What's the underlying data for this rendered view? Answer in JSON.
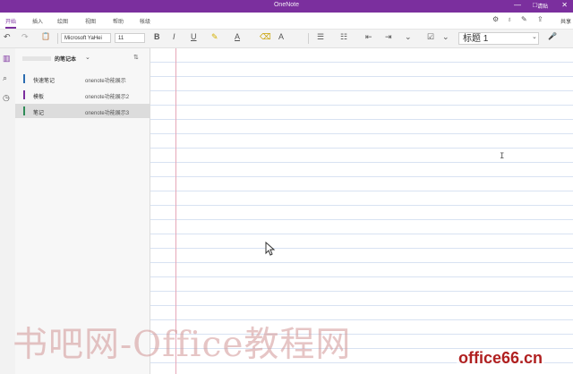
{
  "app_title": "OneNote",
  "user": "请贴",
  "window_controls": [
    "—",
    "□",
    "✕"
  ],
  "tabs": [
    "开始",
    "插入",
    "绘图",
    "视图",
    "帮助",
    "帐级"
  ],
  "active_tab_index": 0,
  "share_label": "共享",
  "toolbar": {
    "undo": "↶",
    "redo": "↷",
    "clipboard": "📋",
    "font_name": "Microsoft YaHei",
    "font_size": "11",
    "bold": "B",
    "italic": "I",
    "underline": "U",
    "highlight": "✎",
    "font_color": "A",
    "eraser": "⌫",
    "styles": "A",
    "bullets": "☰",
    "numbering": "☷",
    "outdent": "⇤",
    "indent": "⇥",
    "checkbox": "☑",
    "style_value": "标题 1",
    "mic": "🎤",
    "bullet_dropdown": "⌄"
  },
  "leftnav": {
    "notebooks_icon": "▥",
    "search_icon": "⌕",
    "recent_icon": "◷"
  },
  "notebook": {
    "name": "的笔记本",
    "chevron": "⌄",
    "sort_icon": "⇅"
  },
  "pages": [
    {
      "section": "快速笔记",
      "title": "onenote功能展示",
      "color": "#2b6cb0"
    },
    {
      "section": "模板",
      "title": "onenote功能展示2",
      "color": "#7b2f9e"
    },
    {
      "section": "笔记",
      "title": "onenote功能展示3",
      "color": "#2e8b57"
    }
  ],
  "selected_page_index": 2,
  "watermark": "书吧网-Office教程网",
  "site_watermark": "office66.cn",
  "colors": {
    "accent": "#7b2f9e"
  }
}
